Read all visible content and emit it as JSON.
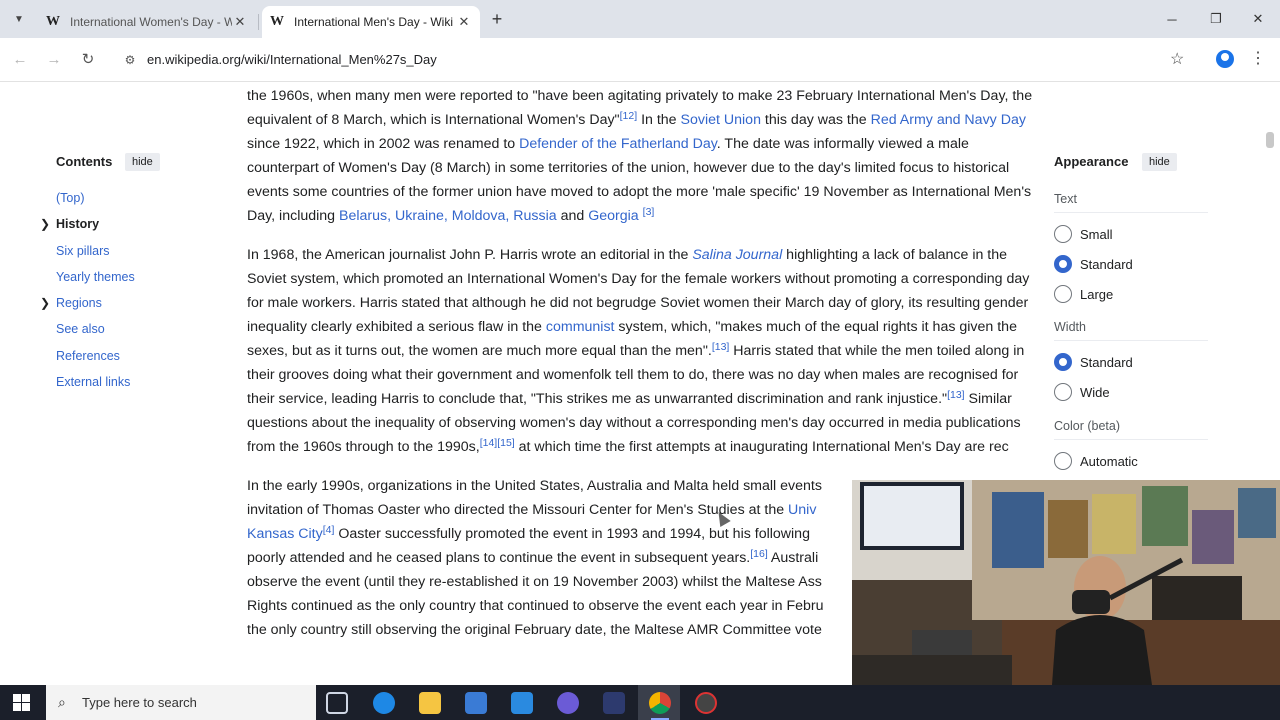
{
  "browser": {
    "tabs": [
      {
        "title": "International Women's Day - W",
        "logo": "W"
      },
      {
        "title": "International Men's Day - Wiki",
        "logo": "W"
      }
    ],
    "new_tab_glyph": "+",
    "url": "en.wikipedia.org/wiki/International_Men%27s_Day"
  },
  "toc": {
    "heading": "Contents",
    "hide_label": "hide",
    "items": [
      "(Top)",
      "History",
      "Six pillars",
      "Yearly themes",
      "Regions",
      "See also",
      "References",
      "External links"
    ]
  },
  "appearance": {
    "heading": "Appearance",
    "hide_label": "hide",
    "text_label": "Text",
    "text_options": [
      "Small",
      "Standard",
      "Large"
    ],
    "text_selected": "Standard",
    "width_label": "Width",
    "width_options": [
      "Standard",
      "Wide"
    ],
    "width_selected": "Standard",
    "color_label": "Color (beta)",
    "color_options": [
      "Automatic"
    ]
  },
  "article": {
    "p1": {
      "a": "the 1960s, when many men were reported to \"have been agitating privately to make 23 February International Men's Day, the equivalent of 8 March, which is International Women's Day\"",
      "ref_a": "[12]",
      "b": " In the ",
      "link_soviet": "Soviet Union",
      "c": " this day was the ",
      "link_red_army": "Red Army and Navy Day",
      "d": " since 1922, which in 2002 was renamed to ",
      "link_defender": "Defender of the Fatherland Day",
      "e": ". The date was informally viewed a male counterpart of Women's Day (8 March) in some territories of the union, however due to the day's limited focus to historical events some countries of the former union have moved to adopt the more 'male specific' 19 November as International Men's Day, including ",
      "link_countries": "Belarus, Ukraine, Moldova, Russia",
      "f": " and ",
      "link_georgia": "Georgia",
      "ref_f": "[3]"
    },
    "p2": {
      "a": "In 1968, the American journalist John P. Harris wrote an editorial in the ",
      "link_salina": "Salina Journal",
      "b": " highlighting a lack of balance in the Soviet system, which promoted an International Women's Day for the female workers without promoting a corresponding day for male workers. Harris stated that although he did not begrudge Soviet women their March day of glory, its resulting gender inequality clearly exhibited a serious flaw in the ",
      "link_communist": "communist",
      "c": " system, which, \"makes much of the equal rights it has given the sexes, but as it turns out, the women are much more equal than the men\".",
      "ref_c": "[13]",
      "d": " Harris stated that while the men toiled along in their grooves doing what their government and womenfolk tell them to do, there was no day when males are recognised for their service, leading Harris to conclude that, \"This strikes me as unwarranted discrimination and rank injustice.\"",
      "ref_d": "[13]",
      "e": " Similar questions about the inequality of observing women's day without a corresponding men's day occurred in media publications from the 1960s through to the 1990s,",
      "ref_e": "[14][15]",
      "f": " at which time the first attempts at inaugurating International Men's Day are rec"
    },
    "p3": {
      "a": "In the early 1990s, organizations in the United States, Australia and Malta held small events",
      "b": " invitation of Thomas Oaster who directed the Missouri Center for Men's Studies at the ",
      "link_univ": "Univ",
      "link_kc": "Kansas City",
      "ref_kc": "[4]",
      "c": " Oaster successfully promoted the event in 1993 and 1994, but his following",
      "d": " poorly attended and he ceased plans to continue the event in subsequent years.",
      "ref_d": "[16]",
      "e": " Australi",
      "f": " observe the event (until they re-established it on 19 November 2003) whilst the Maltese Ass",
      "g": " Rights continued as the only country that continued to observe the event each year in Febru",
      "h": " the only country still observing the original February date, the Maltese AMR Committee vote"
    }
  },
  "taskbar": {
    "search_placeholder": "Type here to search"
  }
}
